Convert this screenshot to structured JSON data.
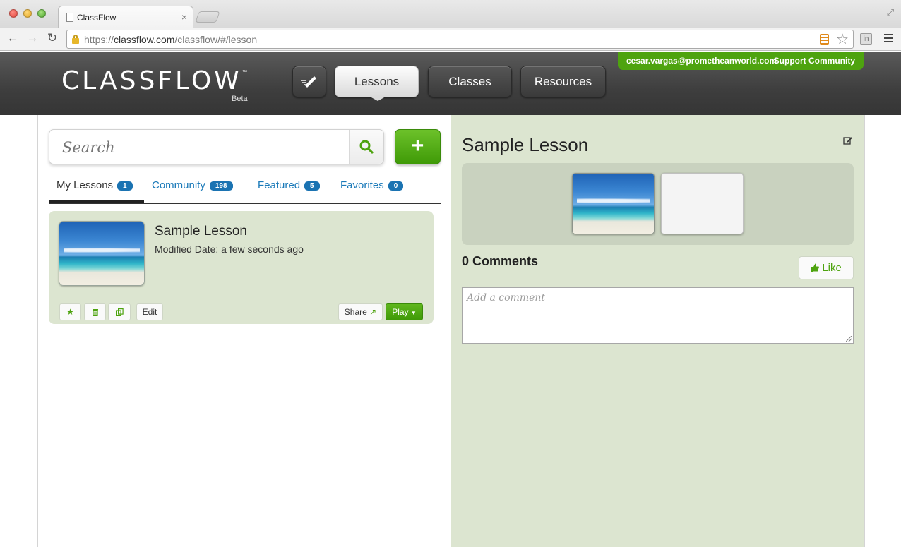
{
  "browser": {
    "tab_title": "ClassFlow",
    "url_scheme": "https://",
    "url_host": "classflow.com",
    "url_path": "/classflow/#/lesson"
  },
  "header": {
    "logo": "CLASSFLOW",
    "logo_tm": "™",
    "logo_beta": "Beta",
    "nav": {
      "lessons": "Lessons",
      "classes": "Classes",
      "resources": "Resources"
    },
    "user_email": "cesar.vargas@prometheanworld.com",
    "support": "Support Community"
  },
  "search": {
    "placeholder": "Search"
  },
  "add_button": "+",
  "tabs": [
    {
      "label": "My Lessons",
      "count": "1"
    },
    {
      "label": "Community",
      "count": "198"
    },
    {
      "label": "Featured",
      "count": "5"
    },
    {
      "label": "Favorites",
      "count": "0"
    }
  ],
  "lesson_card": {
    "title": "Sample Lesson",
    "modified": "Modified Date: a few seconds ago",
    "buttons": {
      "edit": "Edit",
      "share": "Share",
      "play": "Play"
    }
  },
  "detail": {
    "title": "Sample Lesson",
    "comments": "0 Comments",
    "like": "Like",
    "comment_placeholder": "Add a comment"
  },
  "colors": {
    "brand_green": "#4ea30f",
    "link_blue": "#1b7ab9",
    "panel_green": "#dce5d0"
  }
}
